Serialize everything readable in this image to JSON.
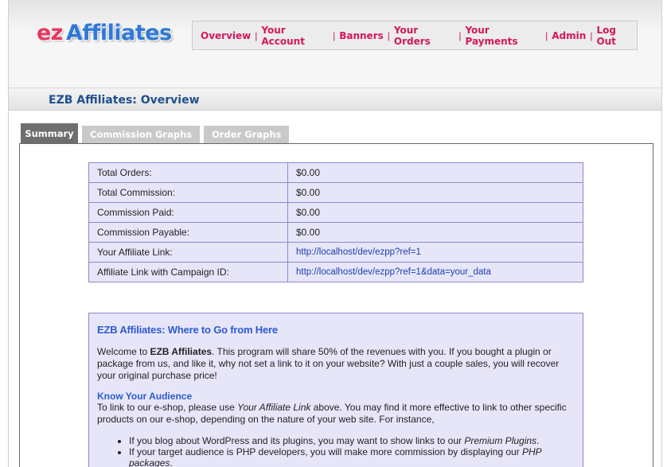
{
  "logo": {
    "part1": "ez",
    "part2": "Affiliates"
  },
  "nav": [
    {
      "label": "Overview"
    },
    {
      "label": "Your Account"
    },
    {
      "label": "Banners"
    },
    {
      "label": "Your Orders"
    },
    {
      "label": "Your Payments"
    },
    {
      "label": "Admin"
    },
    {
      "label": "Log Out"
    }
  ],
  "nav_separator": "|",
  "page_title": "EZB Affiliates: Overview",
  "tabs": [
    {
      "label": "Summary",
      "active": true
    },
    {
      "label": "Commission Graphs",
      "active": false
    },
    {
      "label": "Order Graphs",
      "active": false
    }
  ],
  "stats": [
    {
      "label": "Total Orders:",
      "value": "$0.00"
    },
    {
      "label": "Total Commission:",
      "value": "$0.00"
    },
    {
      "label": "Commission Paid:",
      "value": "$0.00"
    },
    {
      "label": "Commission Payable:",
      "value": "$0.00"
    },
    {
      "label": "Your Affiliate Link:",
      "value": "http://localhost/dev/ezpp?ref=1"
    },
    {
      "label": "Affiliate Link with Campaign ID:",
      "value": "http://localhost/dev/ezpp?ref=1&data=your_data"
    }
  ],
  "info": {
    "heading": "EZB Affiliates: Where to Go from Here",
    "welcome_pre": "Welcome to ",
    "welcome_bold": "EZB Affiliates",
    "welcome_post": ". This program will share 50% of the revenues with you. If you bought a plugin or package from us, and like it, why not set a link to it on your website? With just a couple sales, you will recover your original purchase price!",
    "subheading": "Know Your Audience",
    "audience_pre": "To link to our e-shop, please use ",
    "audience_em": "Your Affiliate Link",
    "audience_post": " above. You may find it more effective to link to other specific products on our e-shop, depending on the nature of your web site. For instance,",
    "bullets": [
      {
        "pre": "If you blog about WordPress and its plugins, you may want to show links to our ",
        "em": "Premium Plugins",
        "post": "."
      },
      {
        "pre": "If your target audience is PHP developers, you will make more commission by displaying our ",
        "em": "PHP packages",
        "post": "."
      }
    ]
  },
  "colors": {
    "accent_nav": "#d4175d",
    "title_blue": "#1f4f8c",
    "link_blue": "#2a5bd0",
    "table_bg": "#e7e6f9",
    "table_border": "#8a89cf"
  }
}
